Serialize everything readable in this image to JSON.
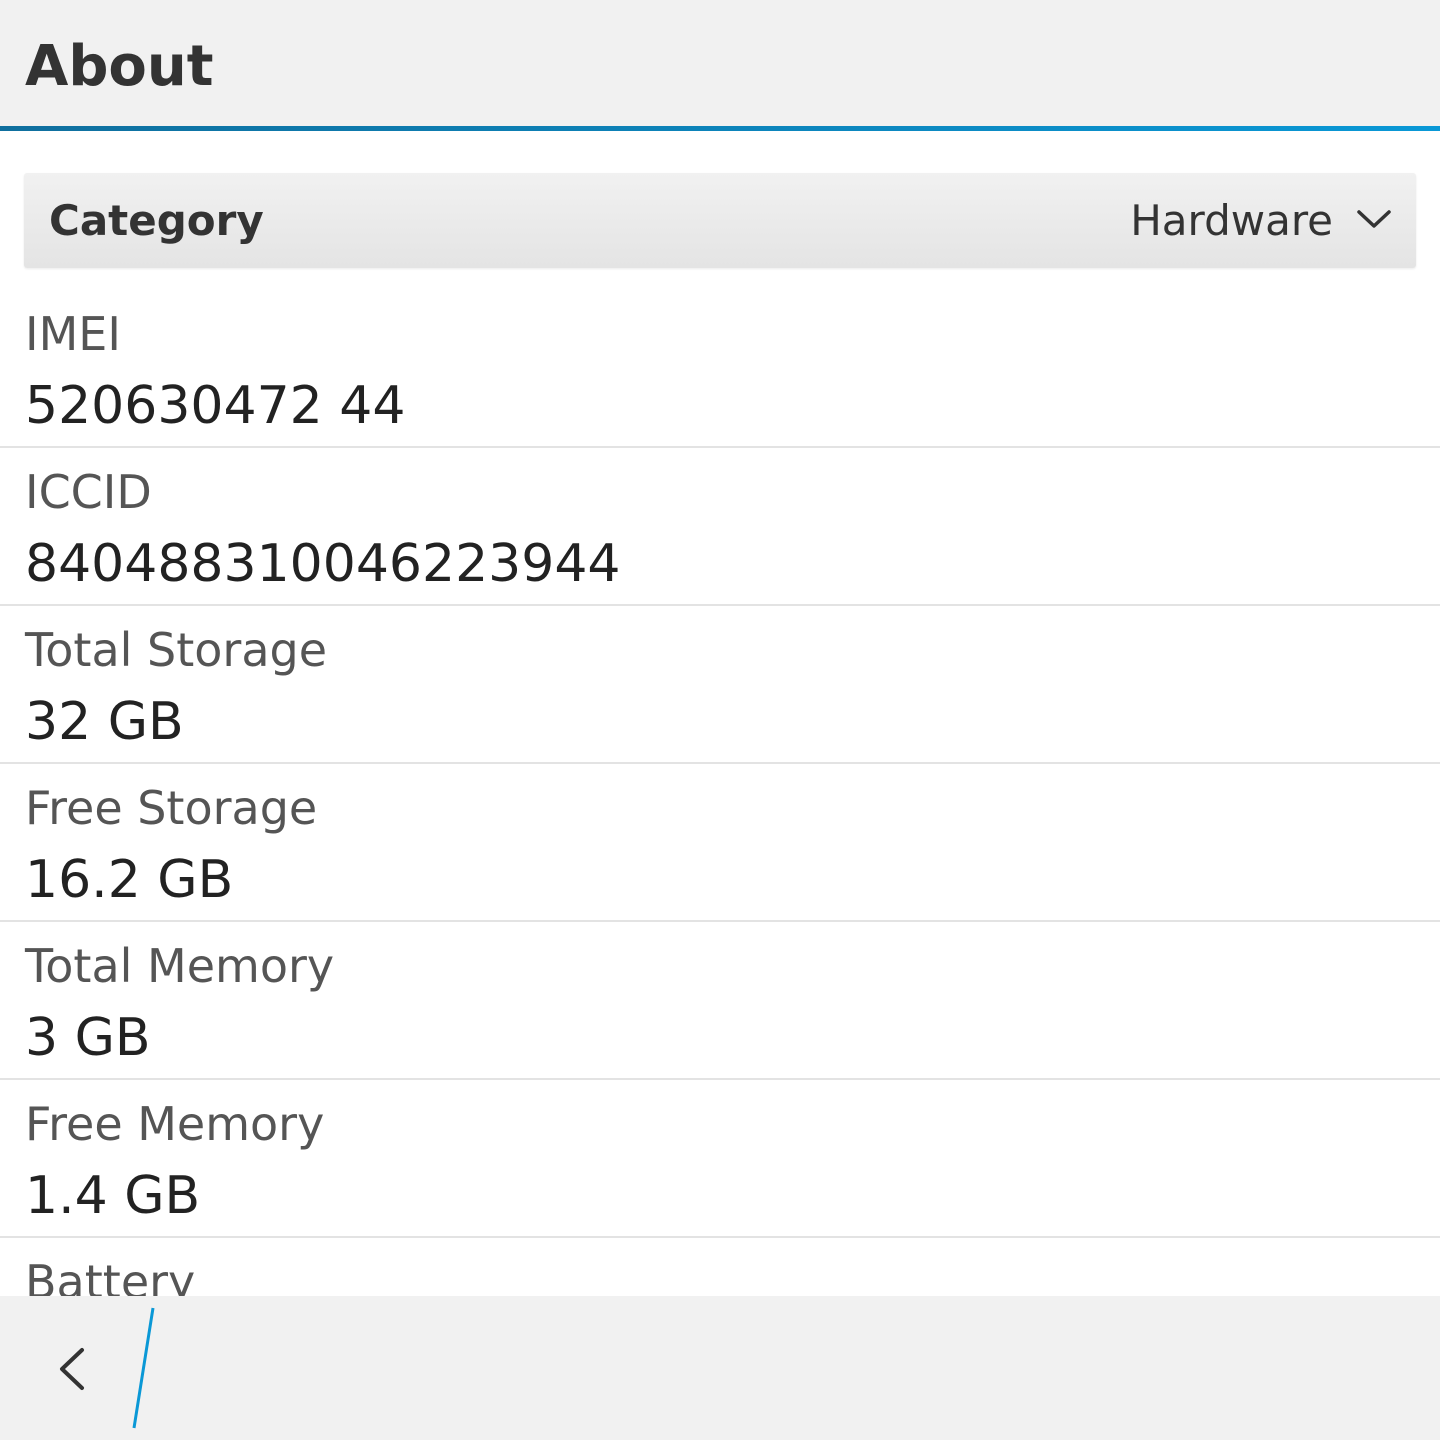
{
  "header": {
    "title": "About"
  },
  "category": {
    "label": "Category",
    "value": "Hardware"
  },
  "rows": [
    {
      "label": "IMEI",
      "value": "520630472 44"
    },
    {
      "label": "ICCID",
      "value": "840488310046223944"
    },
    {
      "label": "Total Storage",
      "value": "32 GB"
    },
    {
      "label": "Free Storage",
      "value": "16.2 GB"
    },
    {
      "label": "Total Memory",
      "value": "3 GB"
    },
    {
      "label": "Free Memory",
      "value": "1.4 GB"
    },
    {
      "label": "Battery",
      "value": ""
    }
  ],
  "colors": {
    "accent": "#0a98d6",
    "header_bg": "#f1f1f1",
    "divider": "#e3e3e3"
  },
  "icons": {
    "dropdown": "chevron-down-icon",
    "back": "chevron-left-icon"
  }
}
